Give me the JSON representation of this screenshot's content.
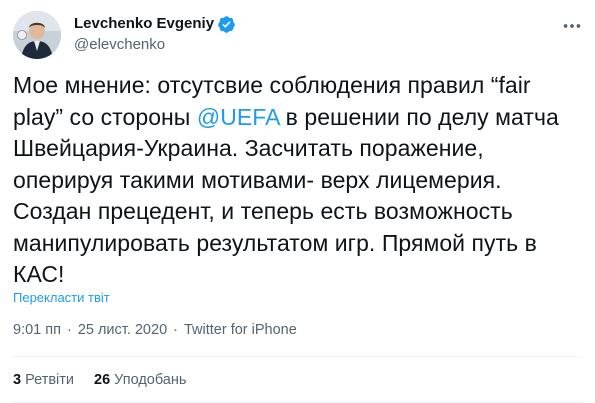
{
  "author": {
    "display_name": "Levchenko Evgeniy",
    "handle": "@elevchenko",
    "verified": true
  },
  "tweet": {
    "lines": [
      [
        {
          "text": "Мое мнение: отсутсвие соблюдения правил “fair"
        }
      ],
      [
        {
          "text": "play” со стороны "
        },
        {
          "text": "@UEFA",
          "mention": true
        },
        {
          "text": " в решении по делу матча"
        }
      ],
      [
        {
          "text": "Швейцария-Украина. Засчитать поражение,"
        }
      ],
      [
        {
          "text": "оперируя такими мотивами- верх лицемерия."
        }
      ],
      [
        {
          "text": "Создан  прецедент, и теперь есть возможность"
        }
      ],
      [
        {
          "text": "манипулировать результатом игр. Прямой путь в"
        }
      ],
      [
        {
          "text": "КАС!"
        }
      ]
    ],
    "translate_label": "Перекласти твіт",
    "time": "9:01 пп",
    "date": "25 лист. 2020",
    "separator": "·",
    "source": "Twitter for iPhone"
  },
  "stats": {
    "retweets_count": "3",
    "retweets_label": "Ретвіти",
    "likes_count": "26",
    "likes_label": "Уподобань"
  },
  "icons": {
    "verified": "verified-badge-icon",
    "more": "more-options-icon"
  },
  "colors": {
    "accent": "#1d9bf0",
    "text": "#0f1419",
    "secondary": "#536471"
  }
}
